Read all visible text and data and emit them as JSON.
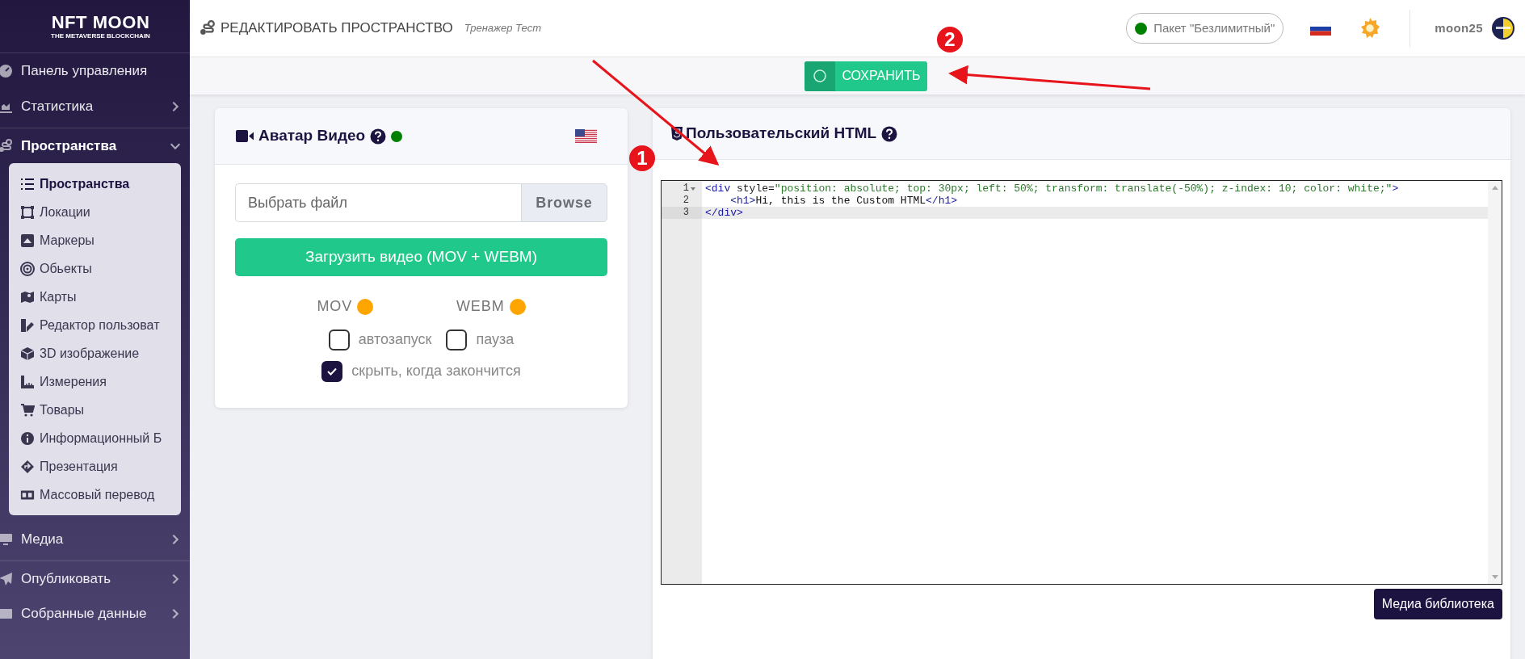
{
  "sidebar": {
    "logo": {
      "title": "NFT MOON",
      "subtitle": "THE METAVERSE BLOCKCHAIN"
    },
    "items": [
      {
        "label": "Панель управления",
        "expanded": false,
        "has_children": false
      },
      {
        "label": "Статистика",
        "expanded": false,
        "has_children": true
      },
      {
        "label": "Пространства",
        "expanded": true,
        "has_children": true,
        "children": [
          {
            "label": "Пространства",
            "selected": true
          },
          {
            "label": "Локации",
            "selected": false
          },
          {
            "label": "Маркеры",
            "selected": false
          },
          {
            "label": "Обьекты",
            "selected": false
          },
          {
            "label": "Карты",
            "selected": false
          },
          {
            "label": "Редактор пользоват",
            "selected": false
          },
          {
            "label": "3D изображение",
            "selected": false
          },
          {
            "label": "Измерения",
            "selected": false
          },
          {
            "label": "Товары",
            "selected": false
          },
          {
            "label": "Информационный Б",
            "selected": false
          },
          {
            "label": "Презентация",
            "selected": false
          },
          {
            "label": "Массовый перевод",
            "selected": false
          }
        ]
      },
      {
        "label": "Медиа",
        "expanded": false,
        "has_children": true
      },
      {
        "label": "Опубликовать",
        "expanded": false,
        "has_children": true
      },
      {
        "label": "Собранные данные",
        "expanded": false,
        "has_children": true
      }
    ]
  },
  "header": {
    "title": "РЕДАКТИРОВАТЬ ПРОСТРАНСТВО",
    "subtitle": "Тренажер Тест",
    "plan": {
      "label": "Пакет \"Безлимитный\"",
      "color": "#008000"
    },
    "username": "moon25"
  },
  "save_button": {
    "label": "СОХРАНИТЬ"
  },
  "avatar_card": {
    "title": "Аватар Видео",
    "status": {
      "color": "#008000"
    },
    "file_input": {
      "placeholder": "Выбрать файл",
      "browse": "Browse"
    },
    "upload_button": "Загрузить видео (MOV + WEBM)",
    "formats": [
      {
        "label": "MOV",
        "color": "#ffa500"
      },
      {
        "label": "WEBM",
        "color": "#ffa500"
      }
    ],
    "options": [
      {
        "label": "автозапуск",
        "checked": false
      },
      {
        "label": "пауза",
        "checked": false
      },
      {
        "label": "скрыть, когда закончится",
        "checked": true
      }
    ]
  },
  "html_card": {
    "title": "Пользовательский HTML",
    "editor": {
      "lines": [
        {
          "number": "1",
          "foldable": true,
          "selected": false,
          "tokens": [
            {
              "kind": "tag",
              "text": "<div"
            },
            {
              "kind": "attr",
              "text": " style"
            },
            {
              "kind": "plain",
              "text": "="
            },
            {
              "kind": "string",
              "text": "\"position: absolute; top: 30px; left: 50%; transform: translate(-50%); z-index: 10; color: white;\""
            },
            {
              "kind": "tag",
              "text": ">"
            }
          ]
        },
        {
          "number": "2",
          "foldable": false,
          "selected": false,
          "tokens": [
            {
              "kind": "tag",
              "text": "    <h1>"
            },
            {
              "kind": "plain",
              "text": "Hi, this is the Custom HTML"
            },
            {
              "kind": "tag",
              "text": "</h1>"
            }
          ]
        },
        {
          "number": "3",
          "foldable": false,
          "selected": true,
          "tokens": [
            {
              "kind": "tag",
              "text": "</div>"
            }
          ]
        }
      ]
    },
    "media_button": "Медиа библиотека"
  },
  "annotations": [
    {
      "label": "1"
    },
    {
      "label": "2"
    }
  ]
}
